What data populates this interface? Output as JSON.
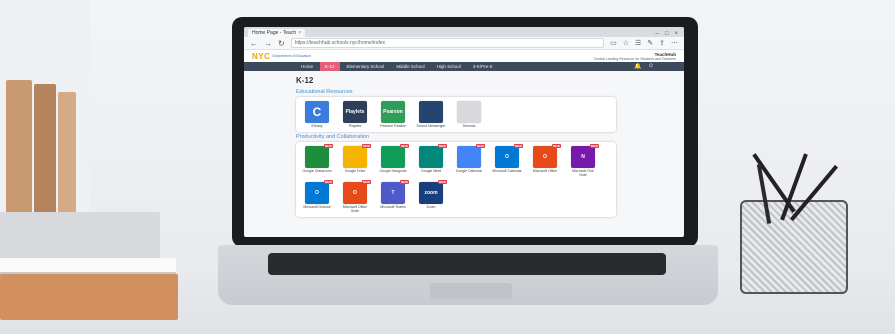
{
  "browser": {
    "tab_title": "Home Page - Teach",
    "url": "https://teachhub.schools.nyc/home/index"
  },
  "site": {
    "logo": "NYC",
    "logo_sub": "Department of Education",
    "hub_title": "TeachHub",
    "hub_subtitle": "Central Landing Resource for Students and Teachers",
    "nav": [
      "Home",
      "K-12",
      "Elementary School",
      "Middle School",
      "High School",
      "3-K/Pre-K"
    ],
    "active_nav": "K-12",
    "page_title": "K-12"
  },
  "sections": [
    {
      "title": "Educational Resources",
      "apps": [
        {
          "label": "iReady",
          "text": "C",
          "color": "#3b7ddd",
          "badge": ""
        },
        {
          "label": "Playlets",
          "text": "Playlets",
          "color": "#2e3f5c",
          "badge": ""
        },
        {
          "label": "Pearson Realize",
          "text": "Pearson",
          "color": "#2f9e5b",
          "badge": ""
        },
        {
          "label": "School Messenger",
          "text": "",
          "color": "#24456e",
          "badge": ""
        },
        {
          "label": "Desmos",
          "text": "",
          "color": "#d7d9dd",
          "badge": ""
        }
      ]
    },
    {
      "title": "Productivity and Collaboration",
      "apps": [
        {
          "label": "Google Classroom",
          "text": "",
          "color": "#1e8e3e",
          "badge": "NEW"
        },
        {
          "label": "Google Drive",
          "text": "",
          "color": "#f4b400",
          "badge": "NEW"
        },
        {
          "label": "Google Hangouts",
          "text": "",
          "color": "#0f9d58",
          "badge": "NEW"
        },
        {
          "label": "Google Meet",
          "text": "",
          "color": "#00897b",
          "badge": "NEW"
        },
        {
          "label": "Google Calendar",
          "text": "",
          "color": "#4285f4",
          "badge": "NEW"
        },
        {
          "label": "Microsoft Calendar",
          "text": "O",
          "color": "#0078d4",
          "badge": "NEW"
        },
        {
          "label": "Microsoft Office",
          "text": "O",
          "color": "#e64a19",
          "badge": "NEW"
        },
        {
          "label": "Microsoft One Note",
          "text": "N",
          "color": "#7719aa",
          "badge": "NEW"
        },
        {
          "label": "Microsoft Outlook",
          "text": "O",
          "color": "#0078d4",
          "badge": "NEW"
        },
        {
          "label": "Microsoft Office Suite",
          "text": "O",
          "color": "#e64a19",
          "badge": "NEW"
        },
        {
          "label": "Microsoft Teams",
          "text": "T",
          "color": "#5059c9",
          "badge": "NEW"
        },
        {
          "label": "Zoom",
          "text": "zoom",
          "color": "#1a3d7c",
          "badge": "NEW"
        }
      ]
    }
  ],
  "icons": {
    "back": "back-arrow-icon",
    "forward": "forward-arrow-icon",
    "refresh": "refresh-icon",
    "reader": "reader-icon",
    "star": "star-icon",
    "favorites": "favorites-icon",
    "notes": "notes-icon",
    "share": "share-icon",
    "more": "more-icon"
  }
}
